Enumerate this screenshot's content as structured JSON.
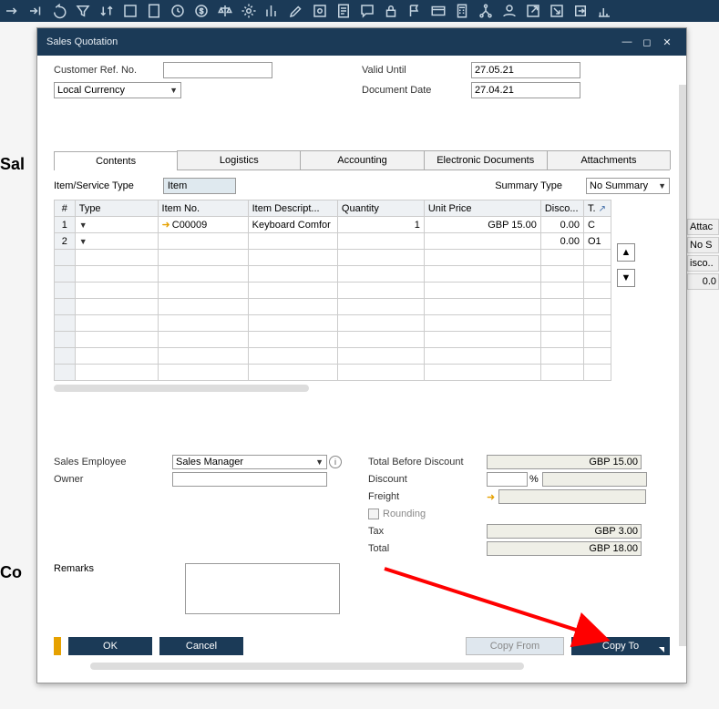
{
  "window": {
    "title": "Sales Quotation"
  },
  "header": {
    "custref_label": "Customer Ref. No.",
    "currency_label": "Local Currency",
    "validuntil_label": "Valid Until",
    "validuntil_value": "27.05.21",
    "docdate_label": "Document Date",
    "docdate_value": "27.04.21"
  },
  "tabs": {
    "contents": "Contents",
    "logistics": "Logistics",
    "accounting": "Accounting",
    "edocs": "Electronic Documents",
    "attachments": "Attachments"
  },
  "contents": {
    "itemservice_label": "Item/Service Type",
    "itemservice_value": "Item",
    "summarytype_label": "Summary Type",
    "summarytype_value": "No Summary",
    "cols": {
      "num": "#",
      "type": "Type",
      "itemno": "Item No.",
      "desc": "Item Descript...",
      "qty": "Quantity",
      "unitprice": "Unit Price",
      "disc": "Disco...",
      "t": "T."
    },
    "rows": [
      {
        "num": "1",
        "type": "",
        "itemno": "C00009",
        "desc": "Keyboard Comfor",
        "qty": "1",
        "unitprice": "GBP 15.00",
        "disc": "0.00",
        "t": "C"
      },
      {
        "num": "2",
        "type": "",
        "itemno": "",
        "desc": "",
        "qty": "",
        "unitprice": "",
        "disc": "0.00",
        "t": "O1"
      }
    ]
  },
  "footer": {
    "salesemp_label": "Sales Employee",
    "salesemp_value": "Sales Manager",
    "owner_label": "Owner",
    "owner_value": "",
    "remarks_label": "Remarks",
    "tbd_label": "Total Before Discount",
    "tbd_value": "GBP 15.00",
    "discount_label": "Discount",
    "discount_pct": "%",
    "freight_label": "Freight",
    "rounding_label": "Rounding",
    "tax_label": "Tax",
    "tax_value": "GBP 3.00",
    "total_label": "Total",
    "total_value": "GBP 18.00"
  },
  "buttons": {
    "ok": "OK",
    "cancel": "Cancel",
    "copyfrom": "Copy From",
    "copyto": "Copy To"
  },
  "bg": {
    "sal": "Sal",
    "co": "Co",
    "attach": "Attac",
    "nos": "No S",
    "disco": "isco..",
    "zero": "0.0"
  }
}
